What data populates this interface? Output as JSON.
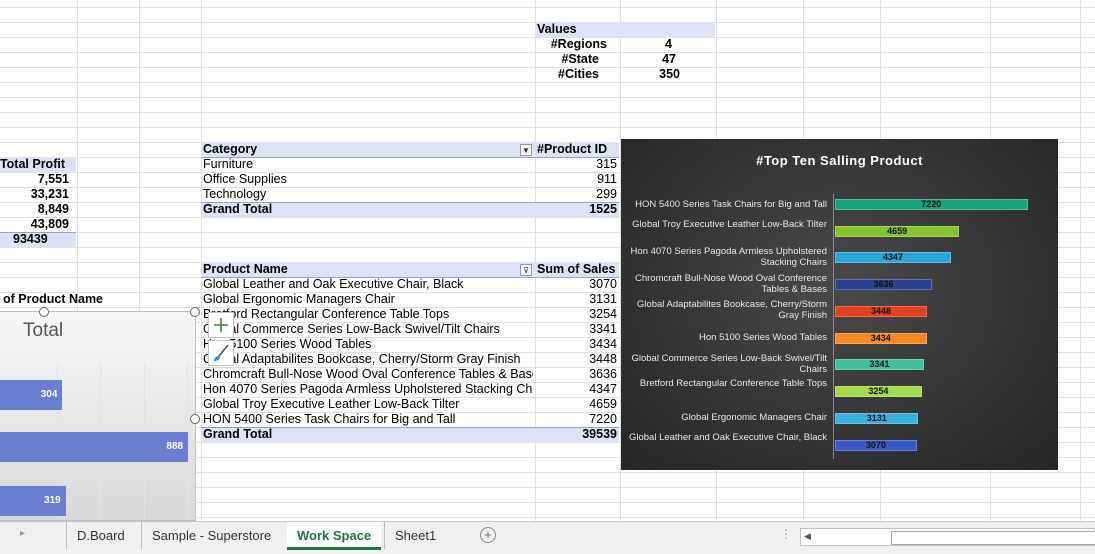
{
  "values_pivot": {
    "title": "Values",
    "rows": [
      {
        "label": "#Regions",
        "value": "4"
      },
      {
        "label": "#State",
        "value": "47"
      },
      {
        "label": "#Cities",
        "value": "350"
      }
    ]
  },
  "profit_pivot": {
    "header": "#Total Profit",
    "values": [
      "7,551",
      "33,231",
      "8,849",
      "43,809"
    ],
    "total": "93439"
  },
  "category_pivot": {
    "col1": "Category",
    "col2": "#Product ID",
    "rows": [
      {
        "label": "Furniture",
        "value": "315"
      },
      {
        "label": "Office Supplies",
        "value": "911"
      },
      {
        "label": "Technology",
        "value": "299"
      }
    ],
    "total_label": "Grand Total",
    "total_value": "1525"
  },
  "product_pivot": {
    "col1": "Product Name",
    "col2": "Sum of Sales",
    "rows": [
      {
        "label": "Global Leather and Oak Executive Chair, Black",
        "value": "3070"
      },
      {
        "label": "Global Ergonomic Managers Chair",
        "value": "3131"
      },
      {
        "label": "Bretford Rectangular Conference Table Tops",
        "value": "3254"
      },
      {
        "label": "Global Commerce Series Low-Back Swivel/Tilt Chairs",
        "value": "3341"
      },
      {
        "label": "Hon 5100 Series Wood Tables",
        "value": "3434"
      },
      {
        "label": "Global Adaptabilites Bookcase, Cherry/Storm Gray Finish",
        "value": "3448"
      },
      {
        "label": "Chromcraft Bull-Nose Wood Oval Conference Tables & Bases",
        "value": "3636"
      },
      {
        "label": "Hon 4070 Series Pagoda Armless Upholstered Stacking Chairs",
        "value": "4347"
      },
      {
        "label": "Global Troy Executive Leather Low-Back Tilter",
        "value": "4659"
      },
      {
        "label": "HON 5400 Series Task Chairs for Big and Tall",
        "value": "7220"
      }
    ],
    "total_label": "Grand Total",
    "total_value": "39539"
  },
  "left_chart": {
    "heading": "of Product Name",
    "title": "Total",
    "bars": [
      {
        "value": 304,
        "label": "304"
      },
      {
        "value": 888,
        "label": "888"
      },
      {
        "value": 319,
        "label": "319"
      }
    ]
  },
  "chart_data": {
    "type": "bar",
    "orientation": "horizontal",
    "title": "#Top Ten Salling Product",
    "categories": [
      "HON 5400 Series Task Chairs for Big and Tall",
      "Global Troy Executive Leather Low-Back Tilter",
      "Hon 4070 Series Pagoda Armless Upholstered Stacking Chairs",
      "Chromcraft Bull-Nose Wood Oval Conference Tables & Bases",
      "Global Adaptabilites Bookcase, Cherry/Storm Gray Finish",
      "Hon 5100 Series Wood Tables",
      "Global Commerce Series Low-Back Swivel/Tilt Chairs",
      "Bretford Rectangular Conference Table Tops",
      "Global Ergonomic Managers Chair",
      "Global Leather and Oak Executive Chair, Black"
    ],
    "values": [
      7220,
      4659,
      4347,
      3636,
      3448,
      3434,
      3341,
      3254,
      3131,
      3070
    ],
    "colors": [
      "#1aa37a",
      "#86c42b",
      "#2aa6d9",
      "#2b3f8f",
      "#e8401c",
      "#f28a1e",
      "#3fbfa0",
      "#a3d94a",
      "#3ab0e0",
      "#3a58c4"
    ],
    "xlim": [
      0,
      7500
    ],
    "grid": false,
    "legend": "none"
  },
  "sheet_tabs": {
    "tabs": [
      "D.Board",
      "Sample - Superstore",
      "Work Space",
      "Sheet1"
    ],
    "active": "Work Space"
  }
}
